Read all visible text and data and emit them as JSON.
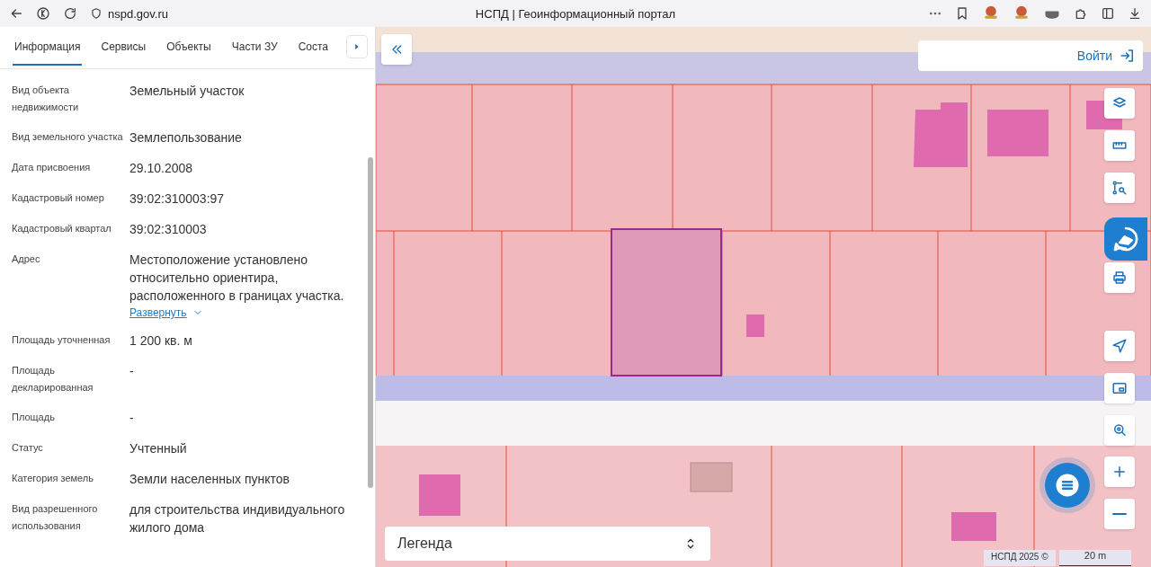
{
  "browser": {
    "url": "nspd.gov.ru",
    "title": "НСПД | Геоинформационный портал"
  },
  "panel": {
    "tabs": [
      {
        "label": "Информация",
        "selected": true
      },
      {
        "label": "Сервисы",
        "selected": false
      },
      {
        "label": "Объекты",
        "selected": false
      },
      {
        "label": "Части ЗУ",
        "selected": false
      },
      {
        "label": "Соста",
        "selected": false
      }
    ],
    "fields": [
      {
        "label": "Вид объекта недвижимости",
        "value": "Земельный участок"
      },
      {
        "label": "Вид земельного участка",
        "value": "Землепользование"
      },
      {
        "label": "Дата присвоения",
        "value": "29.10.2008"
      },
      {
        "label": "Кадастровый номер",
        "value": "39:02:310003:97"
      },
      {
        "label": "Кадастровый квартал",
        "value": "39:02:310003"
      },
      {
        "label": "Адрес",
        "value": "Местоположение установлено относительно ориентира, расположенного в границах участка.",
        "link": "Развернуть"
      },
      {
        "label": "Площадь уточненная",
        "value": "1 200 кв. м"
      },
      {
        "label": "Площадь декларированная",
        "value": "-"
      },
      {
        "label": "Площадь",
        "value": "-"
      },
      {
        "label": "Статус",
        "value": "Учтенный"
      },
      {
        "label": "Категория земель",
        "value": "Земли населенных пунктов"
      },
      {
        "label": "Вид разрешенного использования",
        "value": "для строительства индивидуального жилого дома"
      }
    ]
  },
  "map": {
    "login": "Войти",
    "legend": "Легенда",
    "attribution": "НСПД 2025 ©",
    "scale": "20 m"
  }
}
